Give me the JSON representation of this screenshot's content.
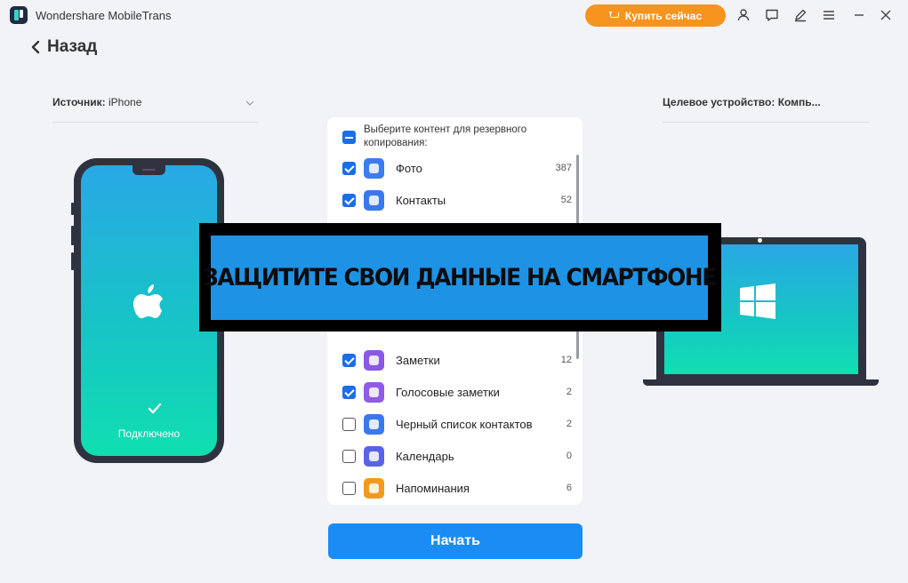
{
  "app": {
    "title": "Wondershare MobileTrans"
  },
  "toolbar": {
    "buy_label": "Купить сейчас",
    "icons": [
      "account-icon",
      "feedback-icon",
      "edit-icon",
      "menu-icon",
      "minimize-icon",
      "close-icon"
    ]
  },
  "nav": {
    "back_label": "Назад"
  },
  "source": {
    "label": "Источник:",
    "value": "iPhone",
    "status": "Подключено"
  },
  "target": {
    "label": "Целевое устройство:",
    "value": "Компь..."
  },
  "content_list": {
    "header": "Выберите контент для резервного копирования:",
    "items": [
      {
        "label": "Фото",
        "count": "387",
        "checked": true,
        "icon": "photo-icon",
        "color": "#3d7bf2"
      },
      {
        "label": "Контакты",
        "count": "52",
        "checked": true,
        "icon": "contacts-icon",
        "color": "#3a78ee"
      },
      {
        "label": "Заметки",
        "count": "12",
        "checked": true,
        "icon": "notes-icon",
        "color": "#8a58e6"
      },
      {
        "label": "Голосовые заметки",
        "count": "2",
        "checked": true,
        "icon": "voice-memo-icon",
        "color": "#8e5ae8"
      },
      {
        "label": "Черный список контактов",
        "count": "2",
        "checked": false,
        "icon": "blocked-contacts-icon",
        "color": "#3a78ee"
      },
      {
        "label": "Календарь",
        "count": "0",
        "checked": false,
        "icon": "calendar-icon",
        "color": "#5a63e8"
      },
      {
        "label": "Напоминания",
        "count": "6",
        "checked": false,
        "icon": "reminders-icon",
        "color": "#f19a1f"
      }
    ]
  },
  "banner": {
    "text": "ЗАЩИТИТЕ СВОИ ДАННЫЕ НА СМАРТФОНЕ"
  },
  "actions": {
    "start_label": "Начать"
  },
  "colors": {
    "accent": "#1a8cf4",
    "buy": "#f7941d",
    "banner_bg": "#1e93e6"
  }
}
